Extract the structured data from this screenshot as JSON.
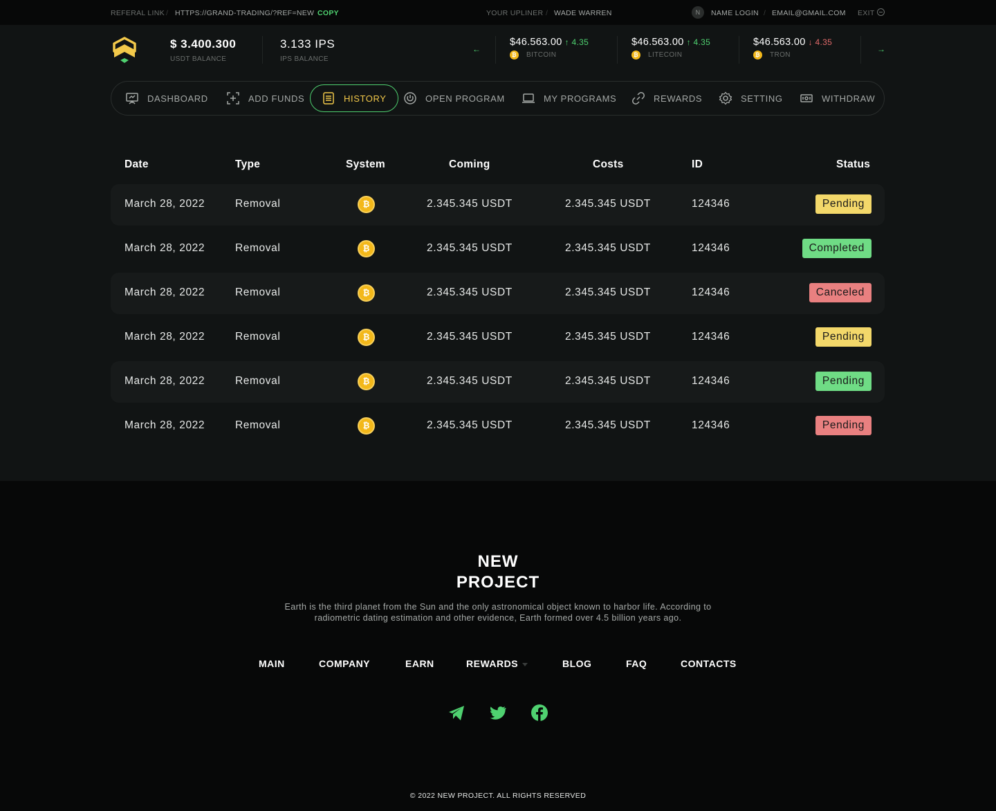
{
  "topbar": {
    "referal_label": "REFERAL LINK",
    "referal_url": "HTTPS://GRAND-TRADING/?REF=NEW",
    "copy_label": "COPY",
    "upliner_label": "YOUR UPLINER",
    "upliner_name": "WADE WARREN",
    "avatar_initial": "N",
    "name_login": "NAME LOGIN",
    "email": "EMAIL@GMAIL.COM",
    "exit_label": "EXIT"
  },
  "balances": {
    "usdt_value": "$ 3.400.300",
    "usdt_label": "USDT BALANCE",
    "ips_value": "3.133 IPS",
    "ips_label": "IPS BALANCE"
  },
  "tickers": [
    {
      "price": "$46.563.00",
      "change": "↑ 4.35",
      "direction": "up",
      "name": "BITCOIN"
    },
    {
      "price": "$46.563.00",
      "change": "↑ 4.35",
      "direction": "up",
      "name": "LITECOIN"
    },
    {
      "price": "$46.563.00",
      "change": "↓ 4.35",
      "direction": "down",
      "name": "TRON"
    }
  ],
  "nav": [
    {
      "label": "DASHBOARD",
      "icon": "presentation-icon"
    },
    {
      "label": "ADD FUNDS",
      "icon": "add-funds-icon"
    },
    {
      "label": "HISTORY",
      "icon": "history-list-icon",
      "active": true
    },
    {
      "label": "OPEN PROGRAM",
      "icon": "power-icon"
    },
    {
      "label": "MY PROGRAMS",
      "icon": "laptop-icon"
    },
    {
      "label": "REWARDS",
      "icon": "link-icon"
    },
    {
      "label": "SETTING",
      "icon": "gear-icon"
    },
    {
      "label": "WITHDRAW",
      "icon": "cash-icon"
    }
  ],
  "table": {
    "headers": [
      "Date",
      "Type",
      "System",
      "Coming",
      "Costs",
      "ID",
      "Status"
    ],
    "rows": [
      {
        "date": "March 28, 2022",
        "type": "Removal",
        "system": "bitcoin-icon",
        "coming": "2.345.345 USDT",
        "costs": "2.345.345 USDT",
        "id": "124346",
        "status": "Pending",
        "status_color": "#f3d86a"
      },
      {
        "date": "March 28, 2022",
        "type": "Removal",
        "system": "bitcoin-icon",
        "coming": "2.345.345 USDT",
        "costs": "2.345.345 USDT",
        "id": "124346",
        "status": "Completed",
        "status_color": "#6fdc85"
      },
      {
        "date": "March 28, 2022",
        "type": "Removal",
        "system": "bitcoin-icon",
        "coming": "2.345.345 USDT",
        "costs": "2.345.345 USDT",
        "id": "124346",
        "status": "Canceled",
        "status_color": "#e98080"
      },
      {
        "date": "March 28, 2022",
        "type": "Removal",
        "system": "bitcoin-icon",
        "coming": "2.345.345 USDT",
        "costs": "2.345.345 USDT",
        "id": "124346",
        "status": "Pending",
        "status_color": "#f3d86a"
      },
      {
        "date": "March 28, 2022",
        "type": "Removal",
        "system": "bitcoin-icon",
        "coming": "2.345.345 USDT",
        "costs": "2.345.345 USDT",
        "id": "124346",
        "status": "Pending",
        "status_color": "#6fdc85"
      },
      {
        "date": "March 28, 2022",
        "type": "Removal",
        "system": "bitcoin-icon",
        "coming": "2.345.345 USDT",
        "costs": "2.345.345 USDT",
        "id": "124346",
        "status": "Pending",
        "status_color": "#e98080"
      }
    ]
  },
  "footer": {
    "title_line1": "NEW",
    "title_line2": "PROJECT",
    "description_line1": "Earth is the third planet from the Sun and the only astronomical object known to harbor life. According to",
    "description_line2": "radiometric dating estimation and other evidence, Earth formed over 4.5 billion years ago.",
    "nav": [
      "MAIN",
      "COMPANY",
      "EARN",
      "REWARDS",
      "BLOG",
      "FAQ",
      "CONTACTS"
    ],
    "social": [
      "telegram-icon",
      "twitter-icon",
      "facebook-icon"
    ],
    "copyright": "© 2022 NEW PROJECT. ALL RIGHTS RESERVED"
  },
  "colors": {
    "accent_green": "#4fd170",
    "accent_yellow": "#f3c94a",
    "bitcoin_orange": "#f3b81a",
    "panel_bg": "#111414",
    "page_bg": "#070808"
  }
}
